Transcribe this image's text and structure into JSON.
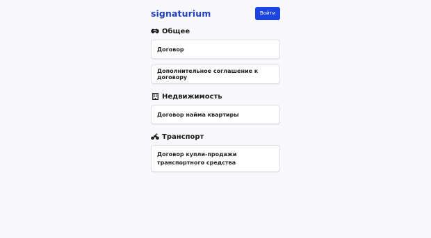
{
  "header": {
    "logo_text": "signaturium",
    "login_label": "Войти"
  },
  "sections": [
    {
      "title": "Общее",
      "icon": "handshake-icon",
      "items": [
        {
          "label": "Договор"
        },
        {
          "label": "Дополнительное соглашение к договору"
        }
      ]
    },
    {
      "title": "Недвижимость",
      "icon": "building-icon",
      "items": [
        {
          "label": "Договор найма квартиры"
        }
      ]
    },
    {
      "title": "Транспорт",
      "icon": "motorcycle-icon",
      "items": [
        {
          "label": "Договор купли-продажи транспортного средства"
        }
      ]
    }
  ],
  "colors": {
    "brand": "#1f3fbf",
    "button": "#1c44e4",
    "background": "#f9f9fb"
  }
}
